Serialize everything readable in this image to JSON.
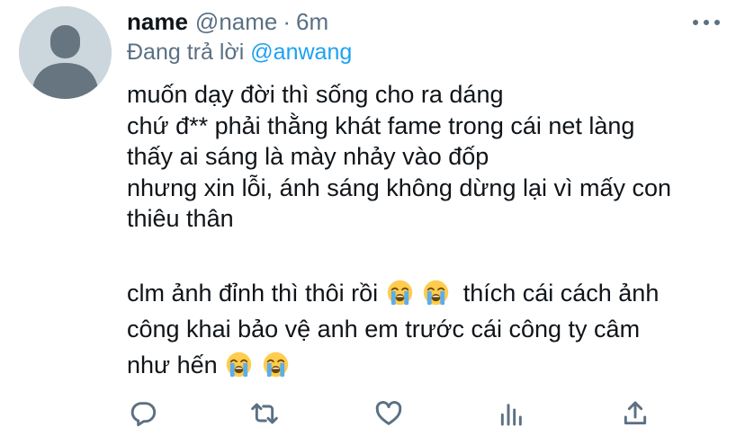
{
  "tweet": {
    "name": "name",
    "handle": "@name",
    "separator": "·",
    "time": "6m",
    "replying_prefix": "Đang trả lời",
    "replying_to": "@anwang",
    "lines": [
      "muốn dạy đời thì sống cho ra dáng",
      "chứ đ** phải thằng khát fame trong cái net làng",
      "thấy ai sáng là mày nhảy vào đốp",
      "nhưng xin lỗi, ánh sáng không dừng lại vì mấy con",
      "thiêu thân"
    ],
    "para2": {
      "line1_a": "clm ảnh đỉnh thì thôi rồi",
      "line1_b": "thích cái cách ảnh",
      "line2": "công khai bảo vệ anh em trước cái công ty câm",
      "line3": "như hến"
    },
    "emoji": "loudly-crying-face"
  },
  "actions": {
    "icons": [
      "reply-icon",
      "retweet-icon",
      "like-icon",
      "analytics-icon",
      "share-icon"
    ],
    "color": "#5b7083"
  },
  "colors": {
    "text": "#0f1419",
    "secondary": "#5b7083",
    "link": "#1da1f2",
    "avatar_bg": "#ccd6dd",
    "avatar_fg": "#66757f"
  }
}
